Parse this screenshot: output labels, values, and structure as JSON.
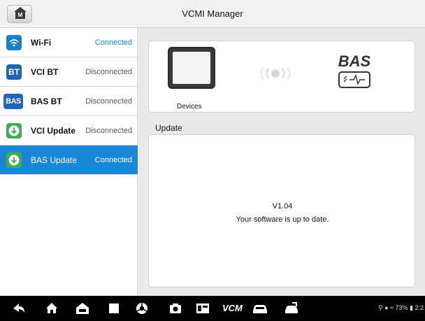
{
  "header": {
    "title": "VCMI Manager",
    "home_icon": "home-m-icon"
  },
  "sidebar": {
    "items": [
      {
        "icon_text": "",
        "icon": "wifi-icon",
        "label": "Wi-Fi",
        "status": "Connected"
      },
      {
        "icon_text": "BT",
        "icon": "bt-icon",
        "label": "VCI BT",
        "status": "Disconnected"
      },
      {
        "icon_text": "BAS",
        "icon": "bas-icon",
        "label": "BAS BT",
        "status": "Disconnected"
      },
      {
        "icon_text": "",
        "icon": "download-icon",
        "label": "VCI Update",
        "status": "Disconnected"
      },
      {
        "icon_text": "",
        "icon": "download-icon",
        "label": "BAS Update",
        "status": "Connected",
        "selected": true
      }
    ]
  },
  "devices": {
    "label": "Devices",
    "bas_logo_text": "BAS"
  },
  "update": {
    "section_label": "Update",
    "version": "V1.04",
    "message": "Your software is up to date."
  },
  "navbar": {
    "icons": [
      "back-icon",
      "home-icon",
      "car-home-icon",
      "recent-apps-icon",
      "browser-icon",
      "camera-icon",
      "screen-capture-icon",
      "vcm-icon",
      "car-icon",
      "car-connect-icon"
    ],
    "vcm_text": "VCM",
    "status_text": "73%",
    "status_time": "2:2"
  },
  "colors": {
    "accent": "#1a88d8",
    "connected": "#1a7ed0",
    "update_green": "#3fae52"
  }
}
